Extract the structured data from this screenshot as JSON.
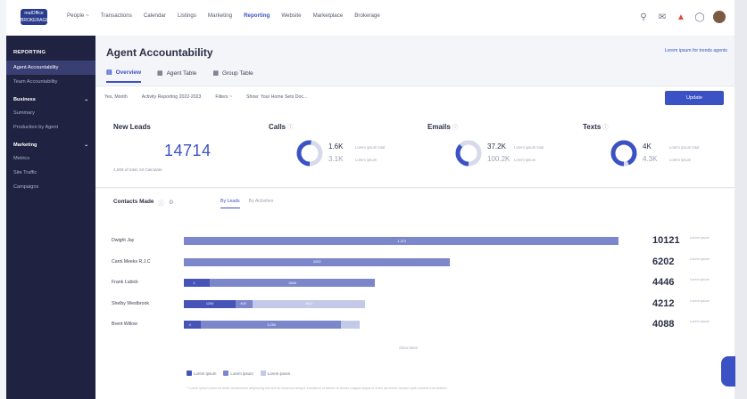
{
  "topbar": {
    "logo_line1": "realOffice",
    "logo_line2": "BROKERAGE",
    "nav": [
      {
        "label": "People ~",
        "active": false
      },
      {
        "label": "Transactions",
        "active": false
      },
      {
        "label": "Calendar",
        "active": false
      },
      {
        "label": "Listings",
        "active": false
      },
      {
        "label": "Marketing",
        "active": false
      },
      {
        "label": "Reporting",
        "active": true
      },
      {
        "label": "Website",
        "active": false
      },
      {
        "label": "Marketplace",
        "active": false
      },
      {
        "label": "Brokerage",
        "active": false
      }
    ],
    "icons": [
      "search-icon",
      "inbox-icon",
      "bell-icon",
      "help-icon",
      "avatar"
    ]
  },
  "sidebar": {
    "header": "REPORTING",
    "items": [
      {
        "label": "Agent Accountability",
        "active": true
      },
      {
        "label": "Team Accountability",
        "active": false
      }
    ],
    "sections": [
      {
        "label": "Business",
        "items": [
          "Summary",
          "Production by Agent"
        ]
      },
      {
        "label": "Marketing",
        "items": [
          "Metrics",
          "Site Traffic",
          "Campaigns"
        ]
      }
    ]
  },
  "page": {
    "title": "Agent Accountability",
    "top_link": "Lorem ipsum for trends agents",
    "tabs": [
      {
        "label": "Overview",
        "icon": "chart-icon",
        "active": true
      },
      {
        "label": "Agent Table",
        "icon": "table-icon",
        "active": false
      },
      {
        "label": "Group Table",
        "icon": "table-icon",
        "active": false
      }
    ],
    "filters": [
      {
        "label": "Yes, Month"
      },
      {
        "label": "Activity Reporting 2022-2023"
      },
      {
        "label": "Filters ~"
      },
      {
        "label": "Show: Your Home Sets Doc..."
      }
    ],
    "update_button": "Update"
  },
  "cards": {
    "new_leads": {
      "title": "New Leads",
      "value": "14714",
      "sub": "4,565 of total, 24 Calculate"
    },
    "metrics": [
      {
        "title": "Calls",
        "v1": "1.6K",
        "l1": "Lorem ipsum total",
        "v2": "3.1K",
        "l2": "Lorem ipsum"
      },
      {
        "title": "Emails",
        "v1": "37.2K",
        "l1": "Lorem ipsum total",
        "v2": "100.2K",
        "l2": "Lorem ipsum"
      },
      {
        "title": "Texts",
        "v1": "4K",
        "l1": "Lorem ipsum total",
        "v2": "4.3K",
        "l2": "Lorem ipsum"
      }
    ]
  },
  "chart": {
    "title": "Contacts Made",
    "tabs": [
      {
        "label": "By Leads",
        "active": true
      },
      {
        "label": "By Activities",
        "active": false
      }
    ],
    "show_more": "Show More",
    "legend": [
      "Lorem ipsum",
      "Lorem ipsum",
      "Lorem ipsum"
    ],
    "note": "* Lorem ipsum dolor sit amet consectetur adipiscing elit sed do eiusmod tempor incididunt ut labore et dolore magna aliqua ut enim ad minim veniam quis nostrud exercitation",
    "colors": {
      "dark": "#4654b8",
      "mid": "#7b86cb",
      "light": "#c4c9e8"
    }
  },
  "chart_data": {
    "type": "bar",
    "orientation": "horizontal",
    "stacked": true,
    "categories": [
      "Dwight Jay",
      "Carol Meeks R.J.C",
      "Frank Lubick",
      "Shelby Westbrook",
      "Brent Willow"
    ],
    "totals": [
      10121,
      6202,
      4446,
      4212,
      4088
    ],
    "total_label": "Lorem ipsum",
    "series": [
      {
        "values": [
          0,
          0,
          600,
          1200,
          400
        ]
      },
      {
        "values": [
          10121,
          6202,
          3846,
          400,
          3250
        ]
      },
      {
        "values": [
          0,
          0,
          0,
          2612,
          438
        ]
      }
    ],
    "segment_labels": [
      [
        "",
        "1,313",
        ""
      ],
      [
        "",
        "6202",
        ""
      ],
      [
        "1",
        "3846",
        ""
      ],
      [
        "1200",
        "400",
        "2612"
      ],
      [
        "4",
        "3,250",
        ""
      ]
    ],
    "xlim": [
      0,
      10121
    ]
  }
}
